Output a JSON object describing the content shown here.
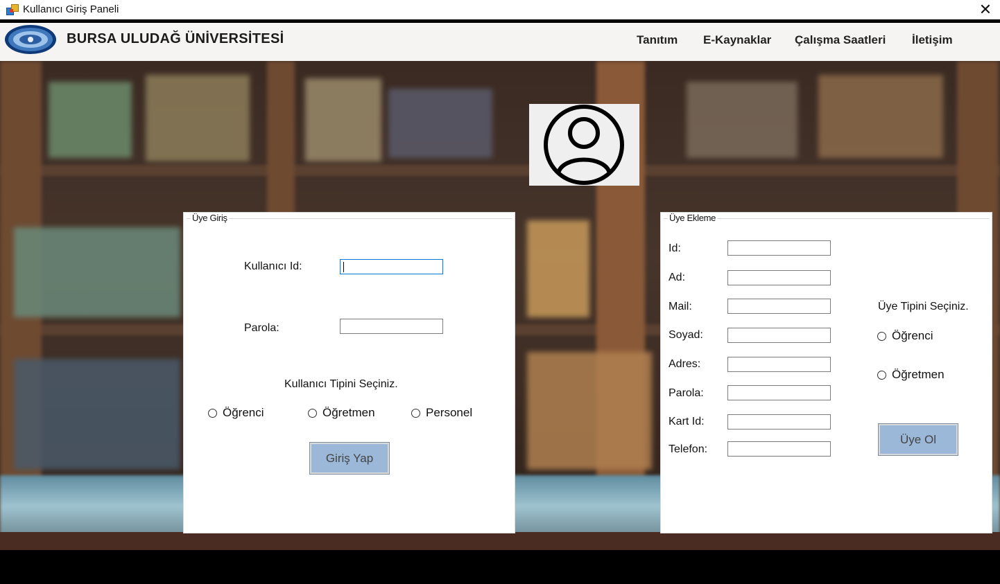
{
  "window": {
    "title": "Kullanıcı Giriş Paneli",
    "close_glyph": "✕"
  },
  "header": {
    "university_name": "BURSA ULUDAĞ ÜNİVERSİTESİ",
    "nav": [
      "Tanıtım",
      "E-Kaynaklar",
      "Çalışma Saatleri",
      "İletişim"
    ],
    "logo_icon": "university-seal-icon"
  },
  "login_panel": {
    "legend": "Üye Giriş",
    "user_id_label": "Kullanıcı Id:",
    "user_id_value": "",
    "password_label": "Parola:",
    "password_value": "",
    "type_prompt": "Kullanıcı Tipini Seçiniz.",
    "types": [
      "Öğrenci",
      "Öğretmen",
      "Personel"
    ],
    "submit_label": "Giriş Yap"
  },
  "register_panel": {
    "legend": "Üye Ekleme",
    "fields": [
      {
        "label": "Id:",
        "value": ""
      },
      {
        "label": "Ad:",
        "value": ""
      },
      {
        "label": "Mail:",
        "value": ""
      },
      {
        "label": "Soyad:",
        "value": ""
      },
      {
        "label": "Adres:",
        "value": ""
      },
      {
        "label": "Parola:",
        "value": ""
      },
      {
        "label": "Kart Id:",
        "value": ""
      },
      {
        "label": "Telefon:",
        "value": ""
      }
    ],
    "type_prompt": "Üye Tipini Seçiniz.",
    "types": [
      "Öğrenci",
      "Öğretmen"
    ],
    "submit_label": "Üye Ol"
  },
  "colors": {
    "button_bg": "#9bb8d8",
    "focus_border": "#0078d7",
    "header_bg": "#f5f4f2"
  },
  "icons": {
    "avatar": "user-circle-icon",
    "app": "app-window-icon"
  }
}
